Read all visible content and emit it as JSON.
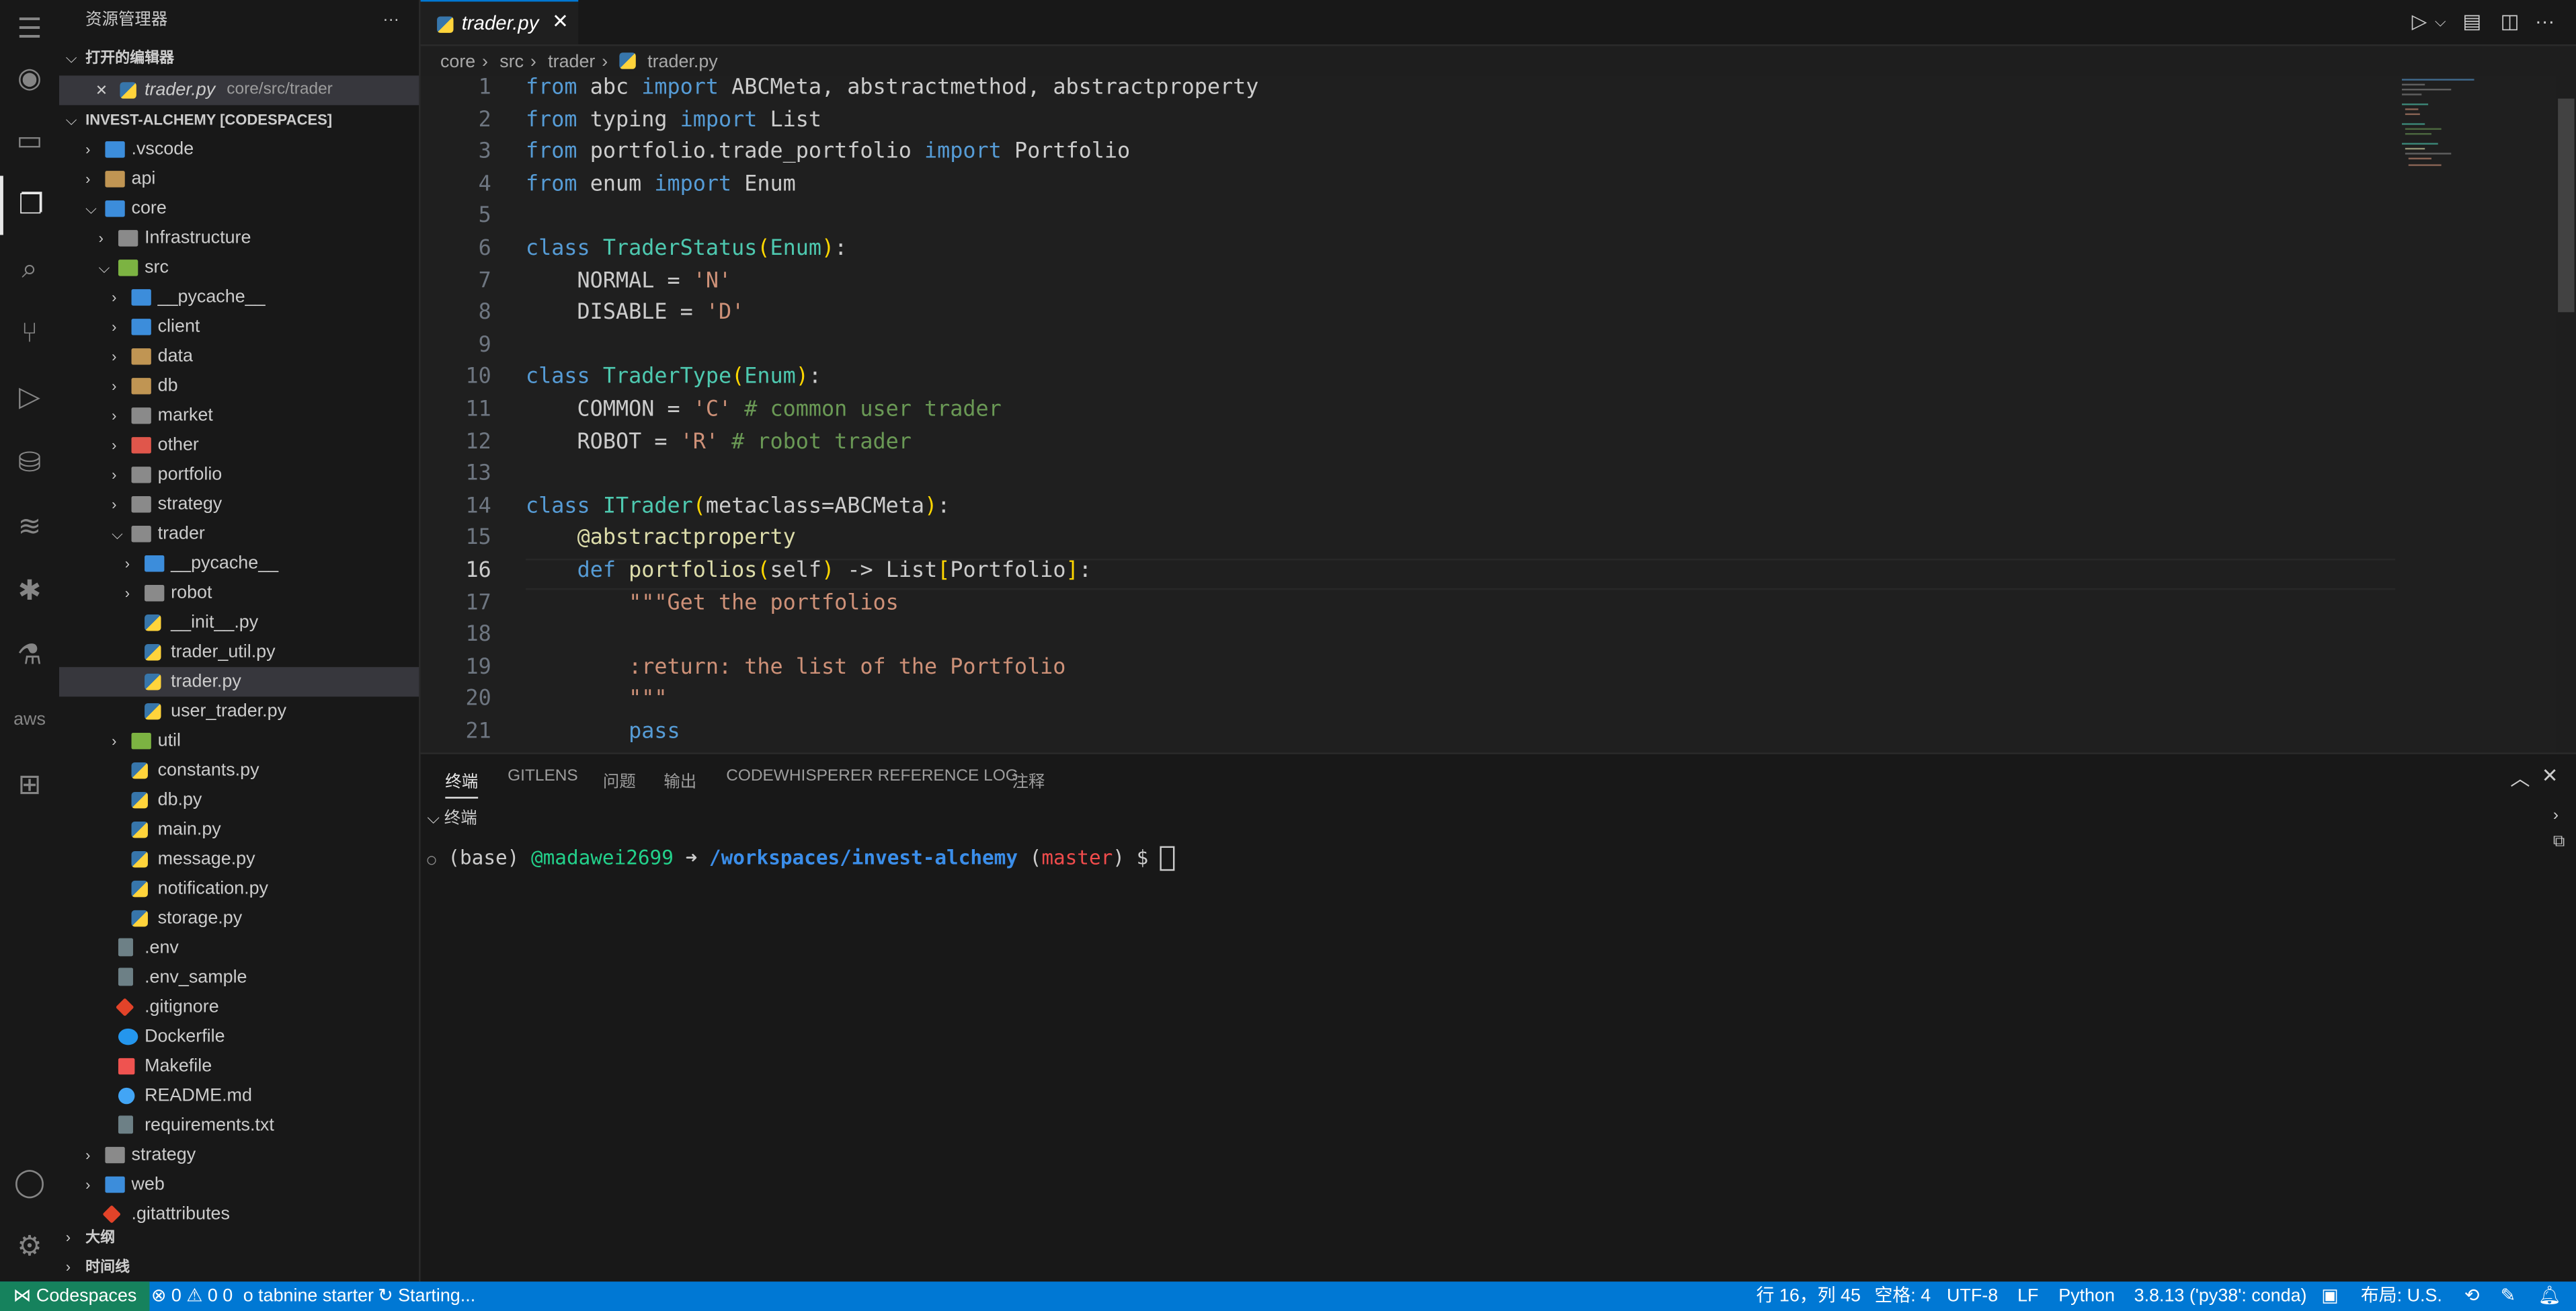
{
  "sidebar": {
    "title": "资源管理器",
    "more": "···",
    "open_editors": "打开的编辑器",
    "open_file": {
      "name": "trader.py",
      "path": "core/src/trader"
    },
    "project": "INVEST-ALCHEMY [CODESPACES]",
    "tree": [
      {
        "name": ".vscode"
      },
      {
        "name": "api"
      },
      {
        "name": "core"
      },
      {
        "name": "Infrastructure"
      },
      {
        "name": "src"
      },
      {
        "name": "__pycache__"
      },
      {
        "name": "client"
      },
      {
        "name": "data"
      },
      {
        "name": "db"
      },
      {
        "name": "market"
      },
      {
        "name": "other"
      },
      {
        "name": "portfolio"
      },
      {
        "name": "strategy"
      },
      {
        "name": "trader"
      },
      {
        "name": "__pycache__"
      },
      {
        "name": "robot"
      },
      {
        "name": "__init__.py"
      },
      {
        "name": "trader_util.py"
      },
      {
        "name": "trader.py"
      },
      {
        "name": "user_trader.py"
      },
      {
        "name": "util"
      },
      {
        "name": "constants.py"
      },
      {
        "name": "db.py"
      },
      {
        "name": "main.py"
      },
      {
        "name": "message.py"
      },
      {
        "name": "notification.py"
      },
      {
        "name": "storage.py"
      },
      {
        "name": ".env"
      },
      {
        "name": ".env_sample"
      },
      {
        "name": ".gitignore"
      },
      {
        "name": "Dockerfile"
      },
      {
        "name": "Makefile"
      },
      {
        "name": "README.md"
      },
      {
        "name": "requirements.txt"
      },
      {
        "name": "strategy"
      },
      {
        "name": "web"
      },
      {
        "name": ".gitattributes"
      }
    ],
    "outline": "大纲",
    "timeline": "时间线"
  },
  "tab": {
    "name": "trader.py",
    "close": "✕"
  },
  "breadcrumb": [
    "core",
    "src",
    "trader",
    "trader.py"
  ],
  "line_numbers": [
    "1",
    "2",
    "3",
    "4",
    "5",
    "6",
    "7",
    "8",
    "9",
    "10",
    "11",
    "12",
    "13",
    "14",
    "15",
    "16",
    "17",
    "18",
    "19",
    "20",
    "21"
  ],
  "panel": {
    "tabs": [
      "终端",
      "GITLENS",
      "问题",
      "输出",
      "CODEWHISPERER REFERENCE LOG",
      "注释"
    ],
    "section": "终端",
    "prompt": {
      "env": "(base)",
      "user": "@madawei2699",
      "arrow": "➜",
      "path": "/workspaces/invest-alchemy",
      "branch": "master",
      "dollar": "$"
    }
  },
  "status": {
    "remote": "Codespaces",
    "errors": "⊗ 0 ⚠ 0",
    "errors2": "0",
    "tabnine": "tabnine starter",
    "starting": "Starting...",
    "position": "行 16，列 45",
    "spaces": "空格: 4",
    "encoding": "UTF-8",
    "eol": "LF",
    "language": "Python",
    "interpreter": "3.8.13 ('py38': conda)",
    "layout": "布局: U.S."
  }
}
